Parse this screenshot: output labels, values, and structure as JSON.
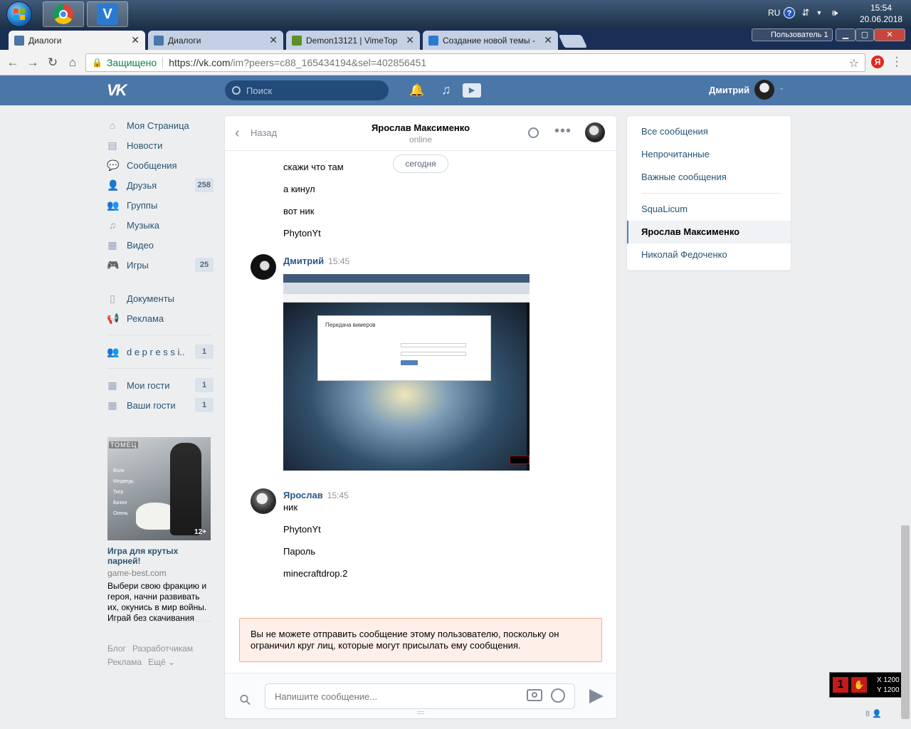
{
  "taskbar": {
    "lang": "RU",
    "time": "15:54",
    "date": "20.06.2018"
  },
  "tabs": [
    {
      "title": "Диалоги",
      "active": true,
      "color": "#4a76a8"
    },
    {
      "title": "Диалоги",
      "active": false,
      "color": "#4a76a8"
    },
    {
      "title": "Demon13121 | VimeTop",
      "active": false,
      "color": "#5a8f29"
    },
    {
      "title": "Создание новой темы -",
      "active": false,
      "color": "#2a7bd0"
    }
  ],
  "window": {
    "profile_label": "Пользователь 1"
  },
  "address": {
    "secure_label": "Защищено",
    "url_host": "https://vk.com",
    "url_path": "/im?peers=c88_165434194&sel=402856451"
  },
  "vk": {
    "search_placeholder": "Поиск",
    "user_name": "Дмитрий"
  },
  "leftnav": {
    "items": [
      {
        "label": "Моя Страница",
        "icon": "home-icon",
        "count": ""
      },
      {
        "label": "Новости",
        "icon": "news-icon",
        "count": ""
      },
      {
        "label": "Сообщения",
        "icon": "messages-icon",
        "count": ""
      },
      {
        "label": "Друзья",
        "icon": "friends-icon",
        "count": "258"
      },
      {
        "label": "Группы",
        "icon": "groups-icon",
        "count": ""
      },
      {
        "label": "Музыка",
        "icon": "music-icon",
        "count": ""
      },
      {
        "label": "Видео",
        "icon": "video-icon",
        "count": ""
      },
      {
        "label": "Игры",
        "icon": "games-icon",
        "count": "25"
      }
    ],
    "docs": [
      {
        "label": "Документы",
        "icon": "documents-icon"
      },
      {
        "label": "Реклама",
        "icon": "ads-icon"
      }
    ],
    "community": {
      "label": "d e p r e s s i..",
      "count": "1"
    },
    "apps": [
      {
        "label": "Мои гости",
        "count": "1"
      },
      {
        "label": "Ваши гости",
        "count": "1"
      }
    ]
  },
  "ad": {
    "brand": "ТОМЕЦ",
    "menu": [
      "Волк",
      "Медведь",
      "Тигр",
      "Бизон",
      "Олень"
    ],
    "age": "12+",
    "title": "Игра для крутых парней!",
    "domain": "game-best.com",
    "text": "Выбери свою фракцию и героя, начни развивать их, окунись в мир войны. Играй без скачивания"
  },
  "footer": {
    "links": [
      "Блог",
      "Разработчикам",
      "Реклама",
      "Ещё ⌄"
    ]
  },
  "dialog": {
    "back_label": "Назад",
    "peer_name": "Ярослав Максименко",
    "peer_status": "online",
    "date_pill": "сегодня",
    "messages_top": [
      "скажи что там",
      "а кинул",
      "вот ник",
      "PhytonYt"
    ],
    "author1": {
      "name": "Дмитрий",
      "time": "15:45"
    },
    "photo_caption": "Передача вимеров",
    "author2": {
      "name": "Ярослав",
      "time": "15:45"
    },
    "messages_bottom": [
      "ник",
      "PhytonYt",
      "Пароль",
      "minecraftdrop.2"
    ],
    "error_text": "Вы не можете отправить сообщение этому пользователю, поскольку он ограничил круг лиц, которые могут присылать ему сообщения.",
    "input_placeholder": "Напишите сообщение..."
  },
  "rightmenu": {
    "items": [
      "Все сообщения",
      "Непрочитанные",
      "Важные сообщения"
    ],
    "peers": [
      "SquaLicum",
      "Ярослав Максименко",
      "Николай Федоченко"
    ],
    "active_peer_index": 1
  },
  "overlay": {
    "x_label": "X 1200",
    "y_label": "Y 1200",
    "online_count": "8"
  }
}
